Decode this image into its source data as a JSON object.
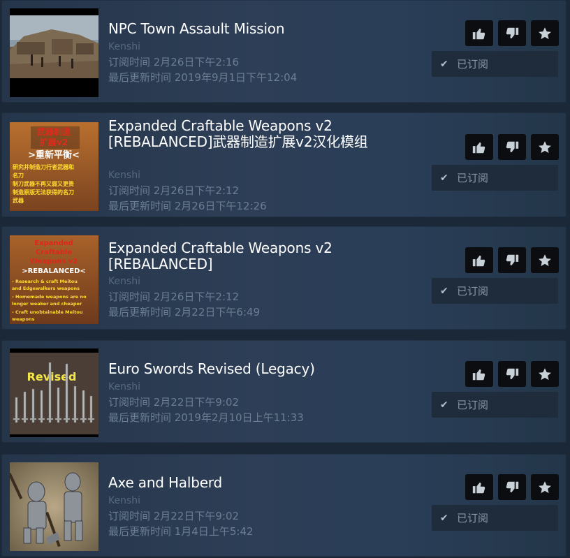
{
  "actions": {
    "thumbs_up": "thumbs-up-icon",
    "thumbs_down": "thumbs-down-icon",
    "favorite": "star-icon"
  },
  "subscribed_label": "已订阅",
  "items": [
    {
      "title": "NPC Town Assault Mission",
      "app": "Kenshi",
      "subscribed": "订阅时间 2月26日下午2:16",
      "updated": "最后更新时间 2019年9月1日下午12:04",
      "thumb_text": []
    },
    {
      "title": "Expanded Craftable Weapons v2 [REBALANCED]武器制造扩展v2汉化模组",
      "app": "Kenshi",
      "subscribed": "订阅时间 2月26日下午2:12",
      "updated": "最后更新时间 2月26日下午12:26",
      "thumb_text": [
        "武器制造",
        "扩展v2",
        ">重新平衡<",
        "研究并制造刀行者武器和",
        "名刀",
        "制刀武器不再又弱又更贵",
        "制造原版无法获得的名刀",
        "武器"
      ]
    },
    {
      "title": "Expanded Craftable Weapons v2 [REBALANCED]",
      "app": "Kenshi",
      "subscribed": "订阅时间 2月26日下午2:12",
      "updated": "最后更新时间 2月22日下午6:49",
      "thumb_text": [
        "Expanded",
        "Craftable",
        "Weapons v2",
        ">REBALANCED<",
        "- Research & craft Meitou",
        "and Edgewalkers weapons",
        "- Homemade weapons are no",
        "longer weaker and cheaper",
        "- Craft unobtainable Meitou",
        "weapons"
      ]
    },
    {
      "title": "Euro Swords Revised (Legacy)",
      "app": "Kenshi",
      "subscribed": "订阅时间 2月22日下午9:02",
      "updated": "最后更新时间 2019年2月10日上午11:33",
      "thumb_text": [
        "Revised"
      ]
    },
    {
      "title": "Axe and Halberd",
      "app": "Kenshi",
      "subscribed": "订阅时间 2月22日下午9:02",
      "updated": "最后更新时间 1月4日上午5:42",
      "thumb_text": []
    }
  ]
}
